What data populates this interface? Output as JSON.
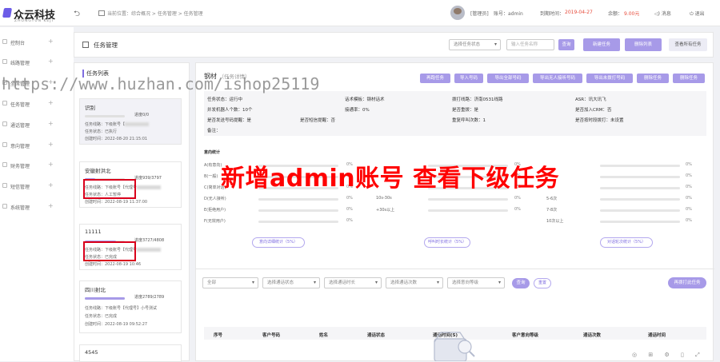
{
  "header": {
    "logo_name": "众云科技",
    "logo_sub": "ZHONGYUN KEJI",
    "breadcrumb": "当前位置：综合概况 > 任务管理 > 任务管理",
    "user_role": "[管理员]",
    "account_label": "账号：admin",
    "expire_label": "到期时间：",
    "expire_date": "2019-04-27",
    "balance_label": "余额：",
    "balance_value": "9.00元",
    "messages": "消息",
    "logout": "退出"
  },
  "sidebar": {
    "items": [
      {
        "label": "控制台"
      },
      {
        "label": "线路管理"
      },
      {
        "label": "坐席管理"
      },
      {
        "label": "任务管理"
      },
      {
        "label": "通话管理"
      },
      {
        "label": "意向管理"
      },
      {
        "label": "财务管理"
      },
      {
        "label": "短信管理"
      },
      {
        "label": "系统管理"
      }
    ]
  },
  "toolbar": {
    "title": "任务管理",
    "status_select": "选择任务状态",
    "search_placeholder": "输入任务名称",
    "query_btn": "查询",
    "new_task_btn": "新建任务",
    "delete_list_btn": "删除列表",
    "view_all_btn": "查看所有任务"
  },
  "task_list": {
    "title": "任务列表",
    "cards": [
      {
        "name": "识别",
        "progress": "进度0/0",
        "fill": 0,
        "lines": [
          "任务线路：下级账号【",
          "任务状态：已执行",
          "创建时间：2022-08-20 21:15:01"
        ]
      },
      {
        "name": "安徽射洪北",
        "progress": "进度939/3797",
        "fill": 0.25,
        "lines": [
          "任务线路：下级账号【代理号",
          "任务状态：人工暂停",
          "创建时间：2022-08-19 11:37:00"
        ]
      },
      {
        "name": "11111",
        "progress": "进度3727/4808",
        "fill": 0.78,
        "lines": [
          "任务线路：下级账号【代理号",
          "任务状态：已完成",
          "创建时间：2022-08-19 10:46"
        ]
      },
      {
        "name": "四川射北",
        "progress": "进度2789/2789",
        "fill": 1,
        "lines": [
          "任务线路：下级账号【代理号】小号测试",
          "任务状态：已完成",
          "创建时间：2022-08-19 09:52:27"
        ]
      },
      {
        "name": "4545",
        "progress": "",
        "fill": 0,
        "lines": []
      }
    ]
  },
  "detail": {
    "name": "钢材",
    "subtitle": "（任务详情）",
    "buttons": [
      "再跑任务",
      "导入号码",
      "导出全部号码",
      "导出无人接听号码",
      "导出未拨打号码",
      "删除任务",
      "删除任务"
    ],
    "info": {
      "status": "任务状态：运行中",
      "template": "话术模板：钢材话术",
      "line": "拨打线路：济南0531线路",
      "asr": "ASR：讯大讯飞",
      "concurrency": "并发机器人个数：10个",
      "connect_rate": "接通率：0%",
      "auto_transfer": "是否重拨：是",
      "crm": "是否加入CRM：否",
      "notice": "是否发送号码提醒：是",
      "sms": "是否短信提醒：否",
      "repeat": "重复呼叫次数：1",
      "time_rule": "是否按时段拨打：未设置",
      "remark": "备注："
    },
    "stats": {
      "col1": {
        "title": "意向统计",
        "rows": [
          {
            "l": "A(有意向)",
            "p": "0%"
          },
          {
            "l": "B(一般)",
            "p": "0%"
          },
          {
            "l": "C(简单对话)",
            "p": "0%"
          },
          {
            "l": "D(无人接听)",
            "p": "0%"
          },
          {
            "l": "E(拒绝用户)",
            "p": "0%"
          },
          {
            "l": "F(无效用户)",
            "p": "0%"
          }
        ],
        "button": "意向详细统计（5%）"
      },
      "col2": {
        "rows": [
          {
            "l": "",
            "p": "0%"
          },
          {
            "l": "",
            "p": "0%"
          },
          {
            "l": "",
            "p": "0%"
          },
          {
            "l": "10s-30s",
            "p": "0%"
          },
          {
            "l": "+30s以上",
            "p": "0%"
          }
        ],
        "button": "呼叫时长统计（5%）"
      },
      "col3": {
        "rows": [
          {
            "l": "",
            "p": "0%"
          },
          {
            "l": "",
            "p": "0%"
          },
          {
            "l": "",
            "p": "0%"
          },
          {
            "l": "5-6次",
            "p": "0%"
          },
          {
            "l": "7-8次",
            "p": "0%"
          },
          {
            "l": "10次以上",
            "p": "0%"
          }
        ],
        "button": "对话轮次统计（5%）"
      }
    },
    "filters": {
      "all": "全部",
      "call_status": "选择通话状态",
      "call_duration": "选择通话时长",
      "call_count": "选择通话次数",
      "intent_level": "选择意向等级",
      "query": "查询",
      "reset": "重置",
      "export": "再拨打此任务"
    },
    "table_headers": [
      "序号",
      "客户号码",
      "姓名",
      "通话状态",
      "通话时间(S)",
      "客户意向等级",
      "通话次数",
      "通话时间"
    ]
  },
  "overlay_text": "新增admin账号 查看下级任务",
  "watermark": "https://www.huzhan.com/ishop25119",
  "colors": {
    "accent": "#a79ae8",
    "red": "#e74c3c",
    "highlight": "#d9001b"
  }
}
